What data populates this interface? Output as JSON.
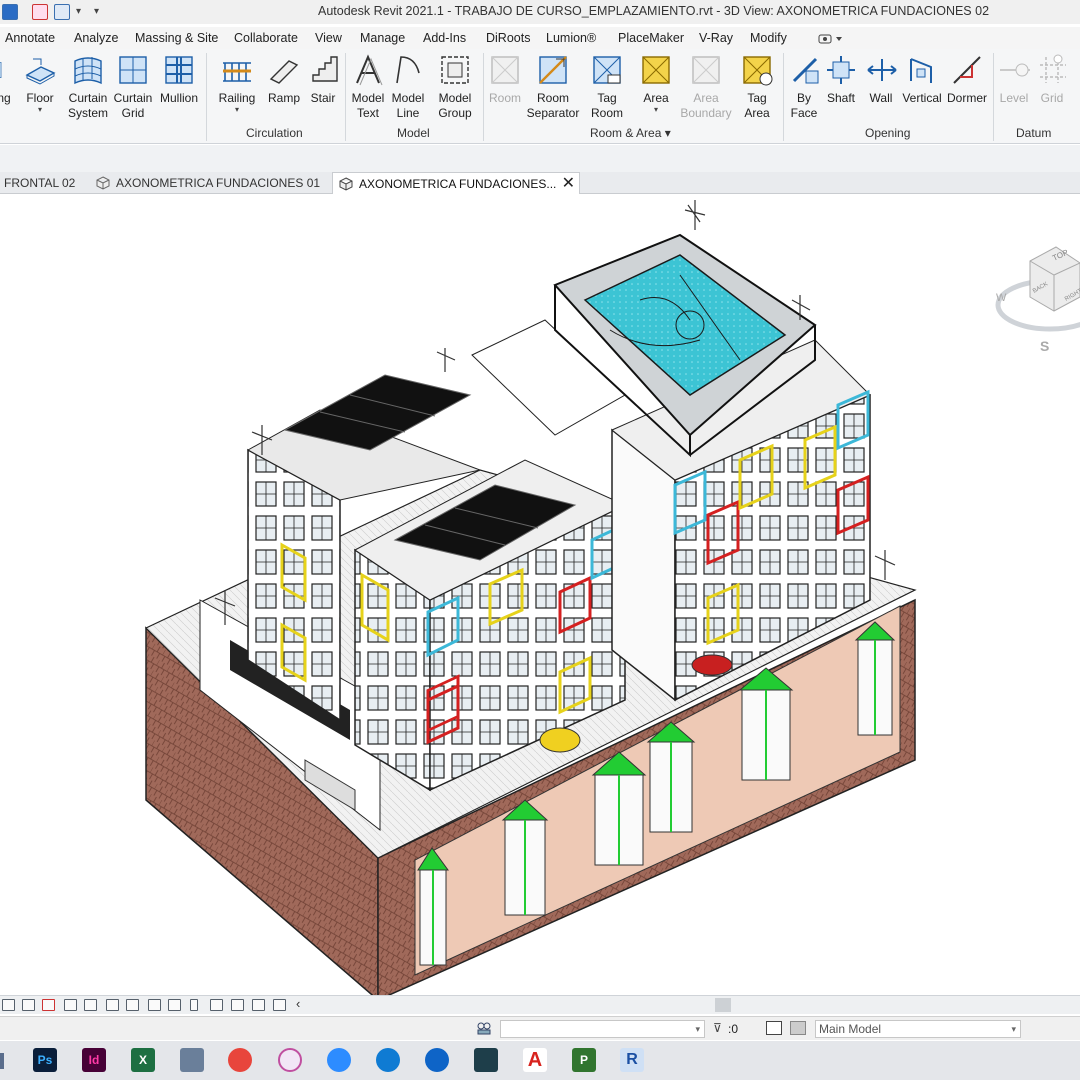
{
  "window": {
    "title": "Autodesk Revit 2021.1 - TRABAJO DE CURSO_EMPLAZAMIENTO.rvt - 3D View: AXONOMETRICA FUNDACIONES 02"
  },
  "ribbon_tabs": [
    "Annotate",
    "Analyze",
    "Massing & Site",
    "Collaborate",
    "View",
    "Manage",
    "Add-Ins",
    "DiRoots",
    "Lumion®",
    "PlaceMaker",
    "V-Ray",
    "Modify"
  ],
  "ribbon": {
    "tools": {
      "ng": "ng",
      "floor": "Floor",
      "curtain_system": "Curtain System",
      "curtain_grid": "Curtain Grid",
      "mullion": "Mullion",
      "railing": "Railing",
      "ramp": "Ramp",
      "stair": "Stair",
      "model_text": "Model Text",
      "model_line": "Model Line",
      "model_group": "Model Group",
      "room": "Room",
      "room_separator": "Room Separator",
      "tag_room": "Tag Room",
      "area": "Area",
      "area_boundary": "Area Boundary",
      "tag_area": "Tag Area",
      "by_face": "By Face",
      "shaft": "Shaft",
      "wall": "Wall",
      "vertical": "Vertical",
      "dormer": "Dormer",
      "level": "Level",
      "grid": "Grid"
    },
    "panels": {
      "circulation": "Circulation",
      "model": "Model",
      "room_area": "Room & Area",
      "opening": "Opening",
      "datum": "Datum"
    }
  },
  "view_tabs": [
    {
      "label": "FRONTAL 02"
    },
    {
      "label": "AXONOMETRICA FUNDACIONES 01"
    },
    {
      "label": "AXONOMETRICA FUNDACIONES..."
    }
  ],
  "viewcube": {
    "top": "TOP",
    "right": "RIGHT",
    "back": "BACK",
    "west": "W",
    "south": "S"
  },
  "statusbar": {
    "filter_count": ":0",
    "model": "Main Model"
  },
  "taskbar": {
    "apps": [
      "Photoshop",
      "InDesign",
      "Excel",
      "Calculator",
      "Chrome",
      "Snipping Tool",
      "Zoom",
      "Edge",
      "TeamViewer",
      "Bitbucket",
      "Acrobat",
      "Project",
      "Revit"
    ],
    "labels": {
      "ps": "Ps",
      "id": "Id",
      "xl": "X",
      "ac": "A",
      "pj": "P",
      "rv": "R"
    }
  },
  "colors": {
    "ribbon_bg": "#f5f6f7",
    "accent": "#2b6cc4",
    "earth": "#a0695a",
    "pool": "#3cc4d4",
    "footing": "#22cc33"
  }
}
